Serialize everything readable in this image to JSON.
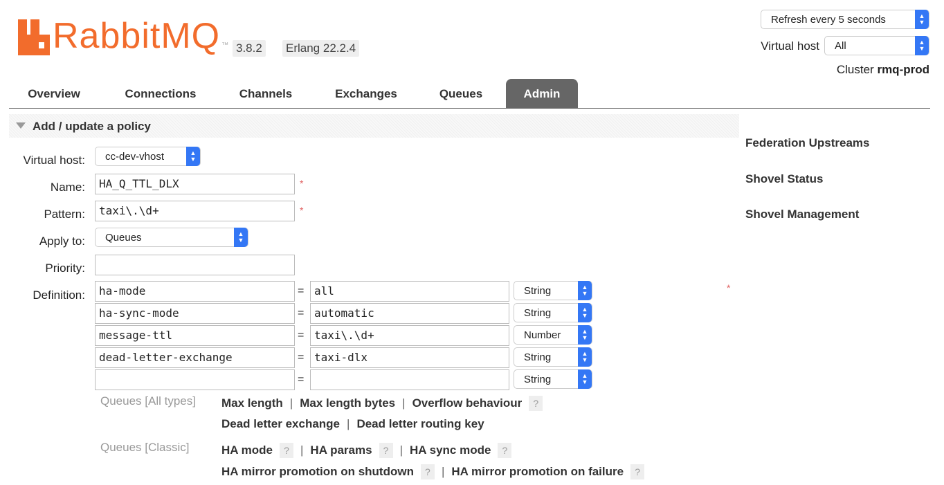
{
  "header": {
    "logo_text": "RabbitMQ",
    "version": "3.8.2",
    "erlang": "Erlang 22.2.4",
    "refresh_select": "Refresh every 5 seconds",
    "vhost_label": "Virtual host",
    "vhost_select": "All",
    "cluster_label": "Cluster",
    "cluster_name": "rmq-prod"
  },
  "tabs": [
    "Overview",
    "Connections",
    "Channels",
    "Exchanges",
    "Queues",
    "Admin"
  ],
  "active_tab": "Admin",
  "section_title": "Add / update a policy",
  "form": {
    "vhost_label": "Virtual host:",
    "vhost_value": "cc-dev-vhost",
    "name_label": "Name:",
    "name_value": "HA_Q_TTL_DLX",
    "pattern_label": "Pattern:",
    "pattern_value": "taxi\\.\\d+",
    "apply_label": "Apply to:",
    "apply_value": "Queues",
    "priority_label": "Priority:",
    "priority_value": "",
    "definition_label": "Definition:",
    "required_mark": "*",
    "eq": "=",
    "definitions": [
      {
        "key": "ha-mode",
        "value": "all",
        "type": "String"
      },
      {
        "key": "ha-sync-mode",
        "value": "automatic",
        "type": "String"
      },
      {
        "key": "message-ttl",
        "value": "taxi\\.\\d+",
        "type": "Number"
      },
      {
        "key": "dead-letter-exchange",
        "value": "taxi-dlx",
        "type": "String"
      },
      {
        "key": "",
        "value": "",
        "type": "String"
      }
    ]
  },
  "help": {
    "all_types_label": "Queues [All types]",
    "classic_label": "Queues [Classic]",
    "sep": "|",
    "q": "?",
    "max_length": "Max length",
    "max_length_bytes": "Max length bytes",
    "overflow": "Overflow behaviour",
    "dlx": "Dead letter exchange",
    "dlrk": "Dead letter routing key",
    "ha_mode": "HA mode",
    "ha_params": "HA params",
    "ha_sync_mode": "HA sync mode",
    "ha_promo_shutdown": "HA mirror promotion on shutdown",
    "ha_promo_failure": "HA mirror promotion on failure"
  },
  "sidebar": [
    "Federation Upstreams",
    "Shovel Status",
    "Shovel Management"
  ],
  "colors": {
    "brand": "#f26c2c",
    "select_arrow": "#3477f5",
    "active_tab": "#666666"
  }
}
